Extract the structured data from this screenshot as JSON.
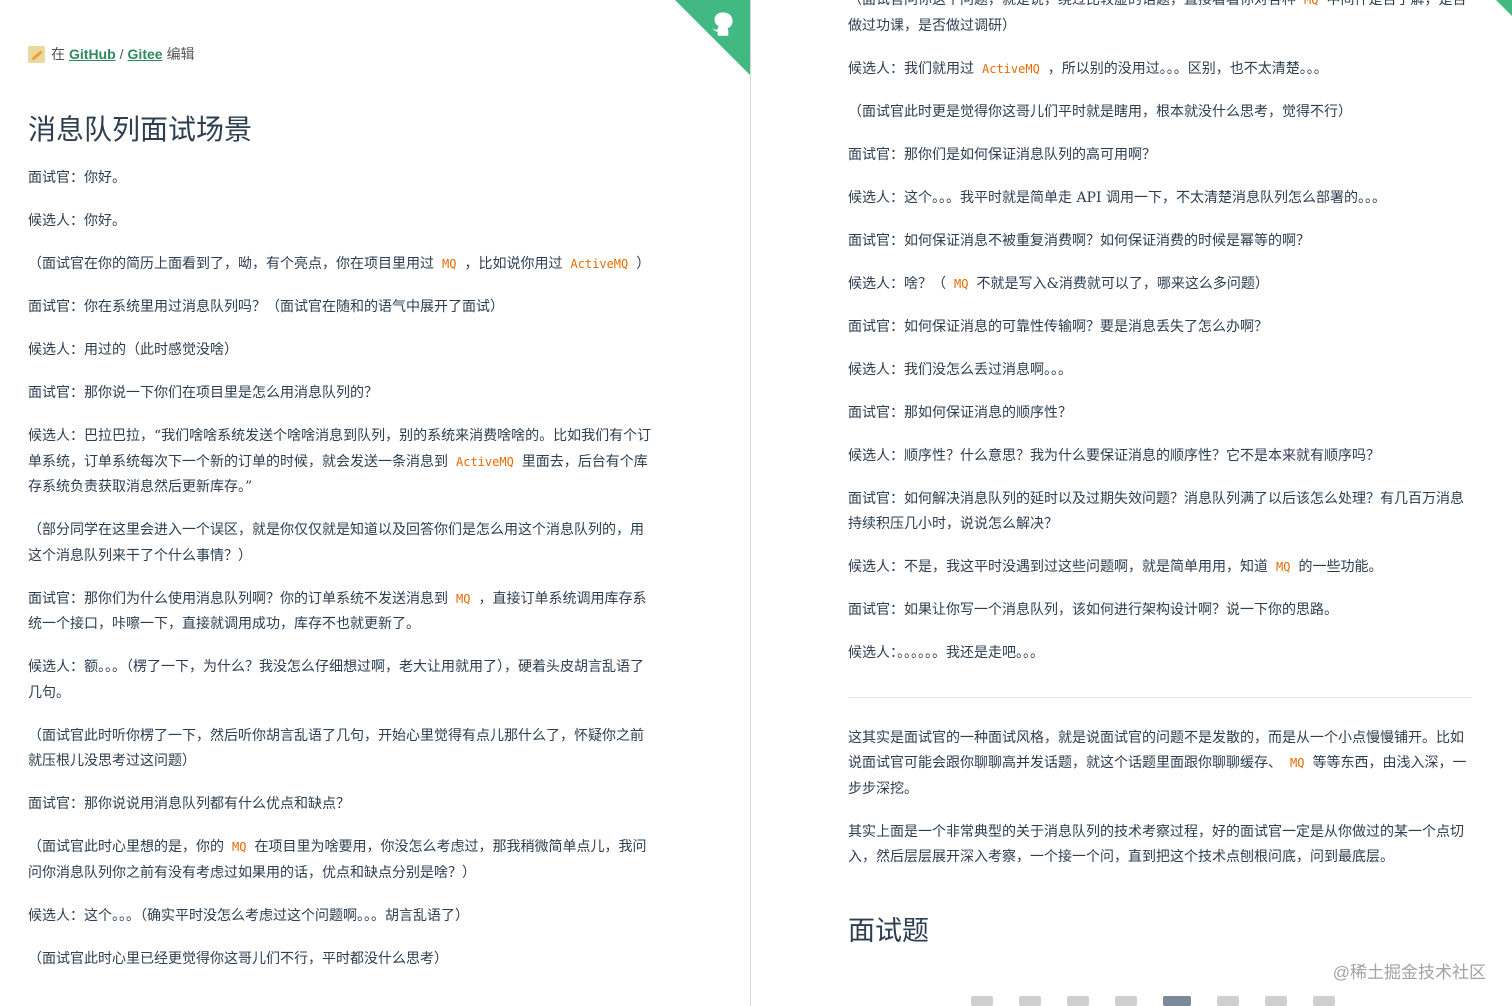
{
  "edit_bar": {
    "prefix": "在",
    "github_label": "GitHub",
    "separator": "/",
    "gitee_label": "Gitee",
    "suffix": "编辑"
  },
  "page_title": "消息队列面试场景",
  "left_paragraphs": [
    {
      "speaker": "面试官：",
      "parts": [
        "你好。"
      ]
    },
    {
      "speaker": "候选人：",
      "parts": [
        "你好。"
      ]
    },
    {
      "speaker": "",
      "parts": [
        "（面试官在你的简历上面看到了，呦，有个亮点，你在项目里用过",
        {
          "code": "MQ"
        },
        "，比如说你用过",
        {
          "code": "ActiveMQ"
        },
        "）"
      ]
    },
    {
      "speaker": "面试官：",
      "parts": [
        "你在系统里用过消息队列吗？（面试官在随和的语气中展开了面试）"
      ]
    },
    {
      "speaker": "候选人：",
      "parts": [
        "用过的（此时感觉没啥）"
      ]
    },
    {
      "speaker": "面试官：",
      "parts": [
        "那你说一下你们在项目里是怎么用消息队列的？"
      ]
    },
    {
      "speaker": "候选人：",
      "parts": [
        "巴拉巴拉，“我们啥啥系统发送个啥啥消息到队列，别的系统来消费啥啥的。比如我们有个订单系统，订单系统每次下一个新的订单的时候，就会发送一条消息到",
        {
          "code": "ActiveMQ"
        },
        "里面去，后台有个库存系统负责获取消息然后更新库存。”"
      ]
    },
    {
      "speaker": "",
      "parts": [
        "（部分同学在这里会进入一个误区，就是你仅仅就是知道以及回答你们是怎么用这个消息队列的，用这个消息队列来干了个什么事情？）"
      ]
    },
    {
      "speaker": "面试官：",
      "parts": [
        "那你们为什么使用消息队列啊？你的订单系统不发送消息到",
        {
          "code": "MQ"
        },
        "，直接订单系统调用库存系统一个接口，咔嚓一下，直接就调用成功，库存不也就更新了。"
      ]
    },
    {
      "speaker": "候选人：",
      "parts": [
        "额。。。（楞了一下，为什么？我没怎么仔细想过啊，老大让用就用了），硬着头皮胡言乱语了几句。"
      ]
    },
    {
      "speaker": "",
      "parts": [
        "（面试官此时听你楞了一下，然后听你胡言乱语了几句，开始心里觉得有点儿那什么了，怀疑你之前就压根儿没思考过这问题）"
      ]
    },
    {
      "speaker": "面试官：",
      "parts": [
        "那你说说用消息队列都有什么优点和缺点？"
      ]
    },
    {
      "speaker": "",
      "parts": [
        "（面试官此时心里想的是，你的",
        {
          "code": "MQ"
        },
        "在项目里为啥要用，你没怎么考虑过，那我稍微简单点儿，我问问你消息队列你之前有没有考虑过如果用的话，优点和缺点分别是啥？）"
      ]
    },
    {
      "speaker": "候选人：",
      "parts": [
        "这个。。。（确实平时没怎么考虑过这个问题啊。。。胡言乱语了）"
      ]
    },
    {
      "speaker": "",
      "parts": [
        "（面试官此时心里已经更觉得你这哥儿们不行，平时都没什么思考）"
      ]
    }
  ],
  "right_paragraphs": [
    {
      "speaker": "",
      "parts": [
        "（面试官问你这个问题，就是说，绕过比较虚的话题，直接看看你对各种",
        {
          "code": "MQ"
        },
        "中间件是否了解，是否做过功课，是否做过调研）"
      ]
    },
    {
      "speaker": "候选人：",
      "parts": [
        "我们就用过",
        {
          "code": "ActiveMQ"
        },
        "，所以别的没用过。。。区别，也不太清楚。。。"
      ]
    },
    {
      "speaker": "",
      "parts": [
        "（面试官此时更是觉得你这哥儿们平时就是瞎用，根本就没什么思考，觉得不行）"
      ]
    },
    {
      "speaker": "面试官：",
      "parts": [
        "那你们是如何保证消息队列的高可用啊？"
      ]
    },
    {
      "speaker": "候选人：",
      "parts": [
        "这个。。。我平时就是简单走 API 调用一下，不太清楚消息队列怎么部署的。。。"
      ]
    },
    {
      "speaker": "面试官：",
      "parts": [
        "如何保证消息不被重复消费啊？如何保证消费的时候是幂等的啊？"
      ]
    },
    {
      "speaker": "候选人：",
      "parts": [
        "啥？（",
        {
          "code": "MQ"
        },
        "不就是写入&消费就可以了，哪来这么多问题）"
      ]
    },
    {
      "speaker": "面试官：",
      "parts": [
        "如何保证消息的可靠性传输啊？要是消息丢失了怎么办啊？"
      ]
    },
    {
      "speaker": "候选人：",
      "parts": [
        "我们没怎么丢过消息啊。。。"
      ]
    },
    {
      "speaker": "面试官：",
      "parts": [
        "那如何保证消息的顺序性？"
      ]
    },
    {
      "speaker": "候选人：",
      "parts": [
        "顺序性？什么意思？我为什么要保证消息的顺序性？它不是本来就有顺序吗？"
      ]
    },
    {
      "speaker": "面试官：",
      "parts": [
        "如何解决消息队列的延时以及过期失效问题？消息队列满了以后该怎么处理？有几百万消息持续积压几小时，说说怎么解决？"
      ]
    },
    {
      "speaker": "候选人：",
      "parts": [
        "不是，我这平时没遇到过这些问题啊，就是简单用用，知道",
        {
          "code": "MQ"
        },
        "的一些功能。"
      ]
    },
    {
      "speaker": "面试官：",
      "parts": [
        "如果让你写一个消息队列，该如何进行架构设计啊？说一下你的思路。"
      ]
    },
    {
      "speaker": "候选人：",
      "parts": [
        "。。。。。。我还是走吧。。。"
      ]
    }
  ],
  "summary_paragraphs": [
    {
      "speaker": "",
      "parts": [
        "这其实是面试官的一种面试风格，就是说面试官的问题不是发散的，而是从一个小点慢慢铺开。比如说面试官可能会跟你聊聊高并发话题，就这个话题里面跟你聊聊缓存、",
        {
          "code": "MQ"
        },
        "等等东西，由浅入深，一步步深挖。"
      ]
    },
    {
      "speaker": "",
      "parts": [
        "其实上面是一个非常典型的关于消息队列的技术考察过程，好的面试官一定是从你做过的某一个点切入，然后层层展开深入考察，一个接一个问，直到把这个技术点刨根问底，问到最底层。"
      ]
    }
  ],
  "section_title": "面试题",
  "watermark": "@稀土掘金技术社区",
  "colors": {
    "accent": "#42b983",
    "code": "#e96900",
    "text": "#2c3e50"
  },
  "icons": {
    "corner": "github-octocat-icon",
    "edit": "pencil-icon"
  }
}
